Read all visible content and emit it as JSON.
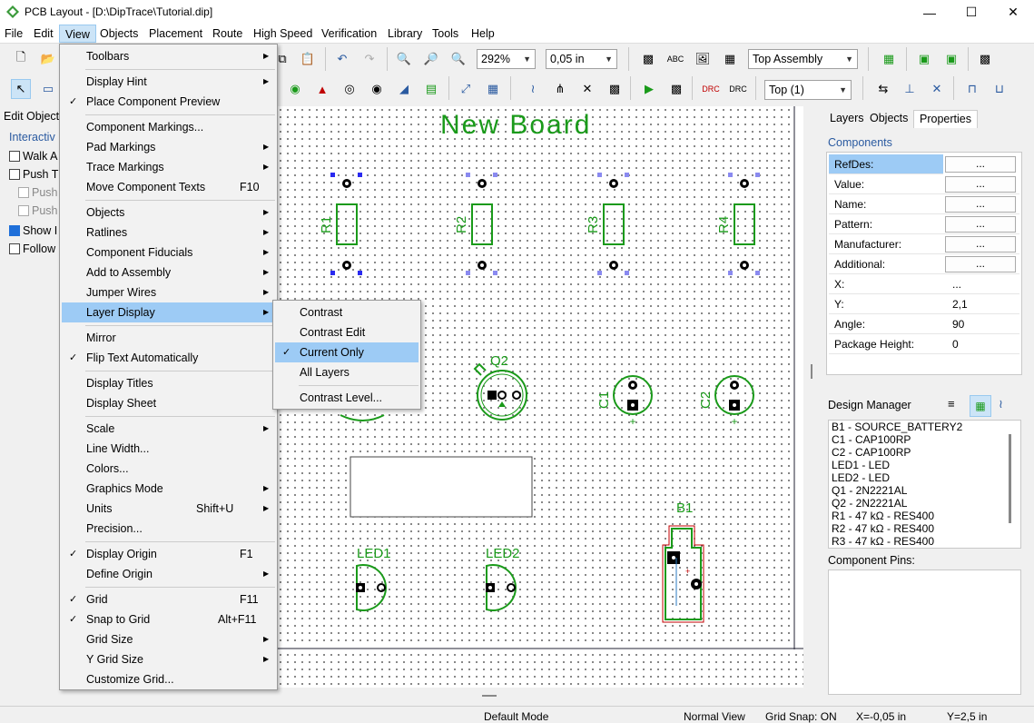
{
  "window": {
    "title": "PCB Layout - [D:\\DipTrace\\Tutorial.dip]"
  },
  "menubar": [
    "File",
    "Edit",
    "View",
    "Objects",
    "Placement",
    "Route",
    "High Speed",
    "Verification",
    "Library",
    "Tools",
    "Help"
  ],
  "toolbar": {
    "zoom": "292%",
    "grid": "0,05 in",
    "assembly": "Top Assembly",
    "layer": "Top (1)"
  },
  "left_panel": {
    "title": "Edit Object",
    "group": "Interactiv",
    "items": [
      {
        "label": "Walk A",
        "checked": false
      },
      {
        "label": "Push T",
        "checked": false
      },
      {
        "label": "Push",
        "checked": false
      },
      {
        "label": "Push",
        "checked": false
      },
      {
        "label": "Show I",
        "checked": true
      },
      {
        "label": "Follow",
        "checked": false
      }
    ]
  },
  "board": {
    "title": "New Board",
    "components": [
      "R1",
      "R2",
      "R3",
      "R4",
      "Q2",
      "C1",
      "C2",
      "B1",
      "LED1",
      "LED2"
    ]
  },
  "view_menu": [
    {
      "label": "Toolbars",
      "sub": true
    },
    {
      "sep": true
    },
    {
      "label": "Display Hint",
      "sub": true
    },
    {
      "label": "Place Component Preview",
      "check": true
    },
    {
      "sep": true
    },
    {
      "label": "Component Markings..."
    },
    {
      "label": "Pad Markings",
      "sub": true
    },
    {
      "label": "Trace Markings",
      "sub": true
    },
    {
      "label": "Move Component Texts",
      "shortcut": "F10"
    },
    {
      "sep": true
    },
    {
      "label": "Objects",
      "sub": true
    },
    {
      "label": "Ratlines",
      "sub": true
    },
    {
      "label": "Component Fiducials",
      "sub": true
    },
    {
      "label": "Add to Assembly",
      "sub": true
    },
    {
      "label": "Jumper Wires",
      "sub": true
    },
    {
      "label": "Layer Display",
      "sub": true,
      "highlight": true
    },
    {
      "sep": true
    },
    {
      "label": "Mirror"
    },
    {
      "label": "Flip Text Automatically",
      "check": true
    },
    {
      "sep": true
    },
    {
      "label": "Display Titles"
    },
    {
      "label": "Display Sheet"
    },
    {
      "sep": true
    },
    {
      "label": "Scale",
      "sub": true
    },
    {
      "label": "Line Width..."
    },
    {
      "label": "Colors..."
    },
    {
      "label": "Graphics Mode",
      "sub": true
    },
    {
      "label": "Units",
      "shortcut": "Shift+U",
      "sub": true
    },
    {
      "label": "Precision..."
    },
    {
      "sep": true
    },
    {
      "label": "Display Origin",
      "shortcut": "F1",
      "check": true
    },
    {
      "label": "Define Origin",
      "sub": true
    },
    {
      "sep": true
    },
    {
      "label": "Grid",
      "shortcut": "F11",
      "check": true
    },
    {
      "label": "Snap to Grid",
      "shortcut": "Alt+F11",
      "check": true
    },
    {
      "label": "Grid Size",
      "sub": true
    },
    {
      "label": "Y Grid Size",
      "sub": true
    },
    {
      "label": "Customize Grid..."
    }
  ],
  "layer_submenu": [
    {
      "label": "Contrast"
    },
    {
      "label": "Contrast Edit"
    },
    {
      "label": "Current Only",
      "check": true,
      "highlight": true
    },
    {
      "label": "All Layers"
    },
    {
      "sep": true
    },
    {
      "label": "Contrast Level..."
    }
  ],
  "right_panel": {
    "tabs": [
      "Layers",
      "Objects",
      "Properties"
    ],
    "section": "Components",
    "properties": [
      {
        "key": "RefDes:",
        "btn": "..."
      },
      {
        "key": "Value:",
        "btn": "..."
      },
      {
        "key": "Name:",
        "btn": "..."
      },
      {
        "key": "Pattern:",
        "btn": "..."
      },
      {
        "key": "Manufacturer:",
        "btn": "..."
      },
      {
        "key": "Additional:",
        "btn": "..."
      },
      {
        "key": "X:",
        "value": "..."
      },
      {
        "key": "Y:",
        "value": "2,1"
      },
      {
        "key": "Angle:",
        "value": "90"
      },
      {
        "key": "Package Height:",
        "value": "0"
      }
    ],
    "design_manager_title": "Design Manager",
    "design_manager": [
      "B1 - SOURCE_BATTERY2",
      "C1 - CAP100RP",
      "C2 - CAP100RP",
      "LED1 - LED",
      "LED2 - LED",
      "Q1 - 2N2221AL",
      "Q2 - 2N2221AL",
      "R1 - 47 kΩ - RES400",
      "R2 - 47 kΩ - RES400",
      "R3 - 47 kΩ - RES400"
    ],
    "pins_title": "Component Pins:"
  },
  "status": {
    "mode": "Default Mode",
    "view": "Normal View",
    "snap": "Grid Snap: ON",
    "x": "X=-0,05 in",
    "y": "Y=2,5 in"
  },
  "colors": {
    "silk": "#1a9a1a",
    "pad": "#000000",
    "select": "#2a2af0",
    "highlight": "#9dcbf5",
    "outline": "#c00000"
  }
}
